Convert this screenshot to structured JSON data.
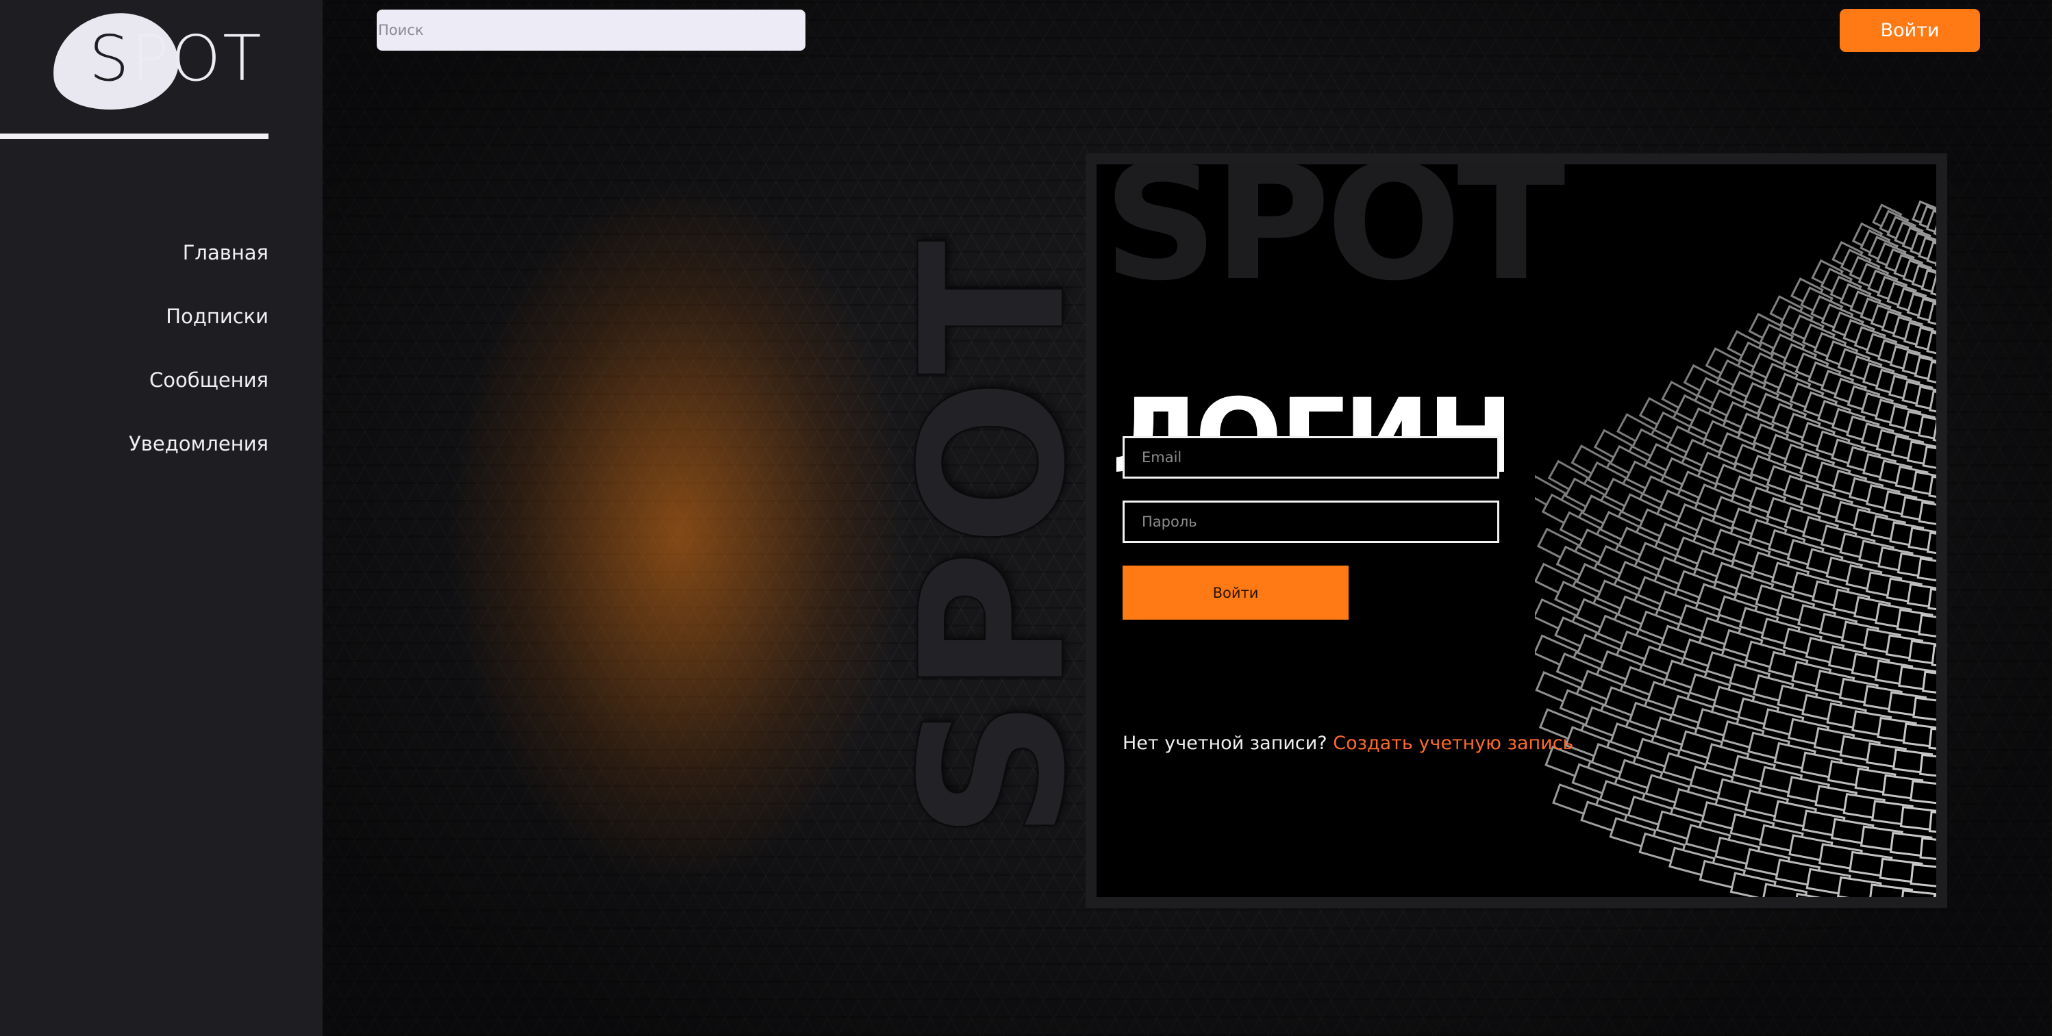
{
  "sidebar": {
    "logo_text": "SPOT",
    "items": [
      {
        "label": "Главная"
      },
      {
        "label": "Подписки"
      },
      {
        "label": "Сообщения"
      },
      {
        "label": "Уведомления"
      }
    ]
  },
  "header": {
    "search_placeholder": "Поиск",
    "login_label": "Войти"
  },
  "hero": {
    "vertical_word": "SPOT"
  },
  "card": {
    "background_word": "SPOT",
    "title": "ЛОГИН",
    "email_placeholder": "Email",
    "password_placeholder": "Пароль",
    "login_button": "Войти",
    "no_account_text": "Нет учетной записи?",
    "create_account_link": "Создать учетную запись"
  },
  "colors": {
    "accent": "#ff7a14",
    "link": "#ff6a2a",
    "sidebar_bg": "#1e1e22",
    "card_bg": "#000000"
  }
}
